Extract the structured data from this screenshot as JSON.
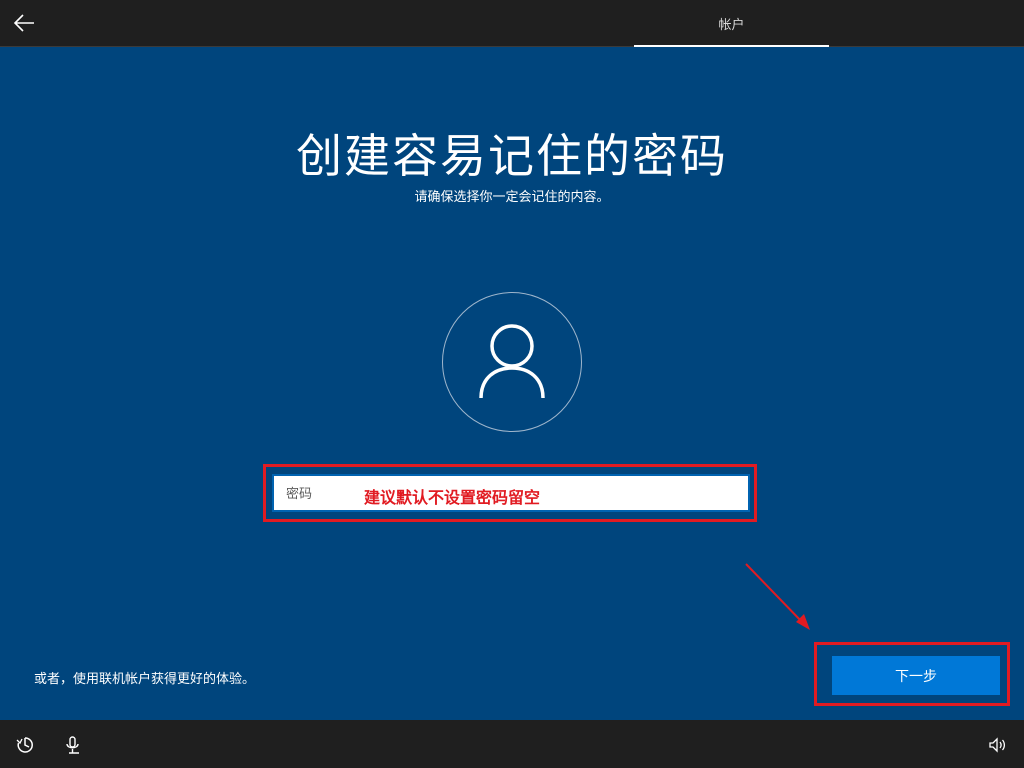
{
  "header": {
    "back_icon": "back-arrow-icon",
    "tab_label": "帐户"
  },
  "main": {
    "title": "创建容易记住的密码",
    "subtitle": "请确保选择你一定会记住的内容。",
    "avatar_icon": "user-icon",
    "password_placeholder": "密码",
    "password_value": "",
    "annotation_text": "建议默认不设置密码留空",
    "alt_link": "或者，使用联机帐户获得更好的体验。",
    "next_label": "下一步"
  },
  "footer": {
    "icons": [
      "ease-of-access-icon",
      "microphone-icon",
      "volume-icon"
    ]
  },
  "colors": {
    "background": "#00457d",
    "bar": "#1f1f1f",
    "accent": "#0078d7",
    "annotation": "#e11b22"
  }
}
